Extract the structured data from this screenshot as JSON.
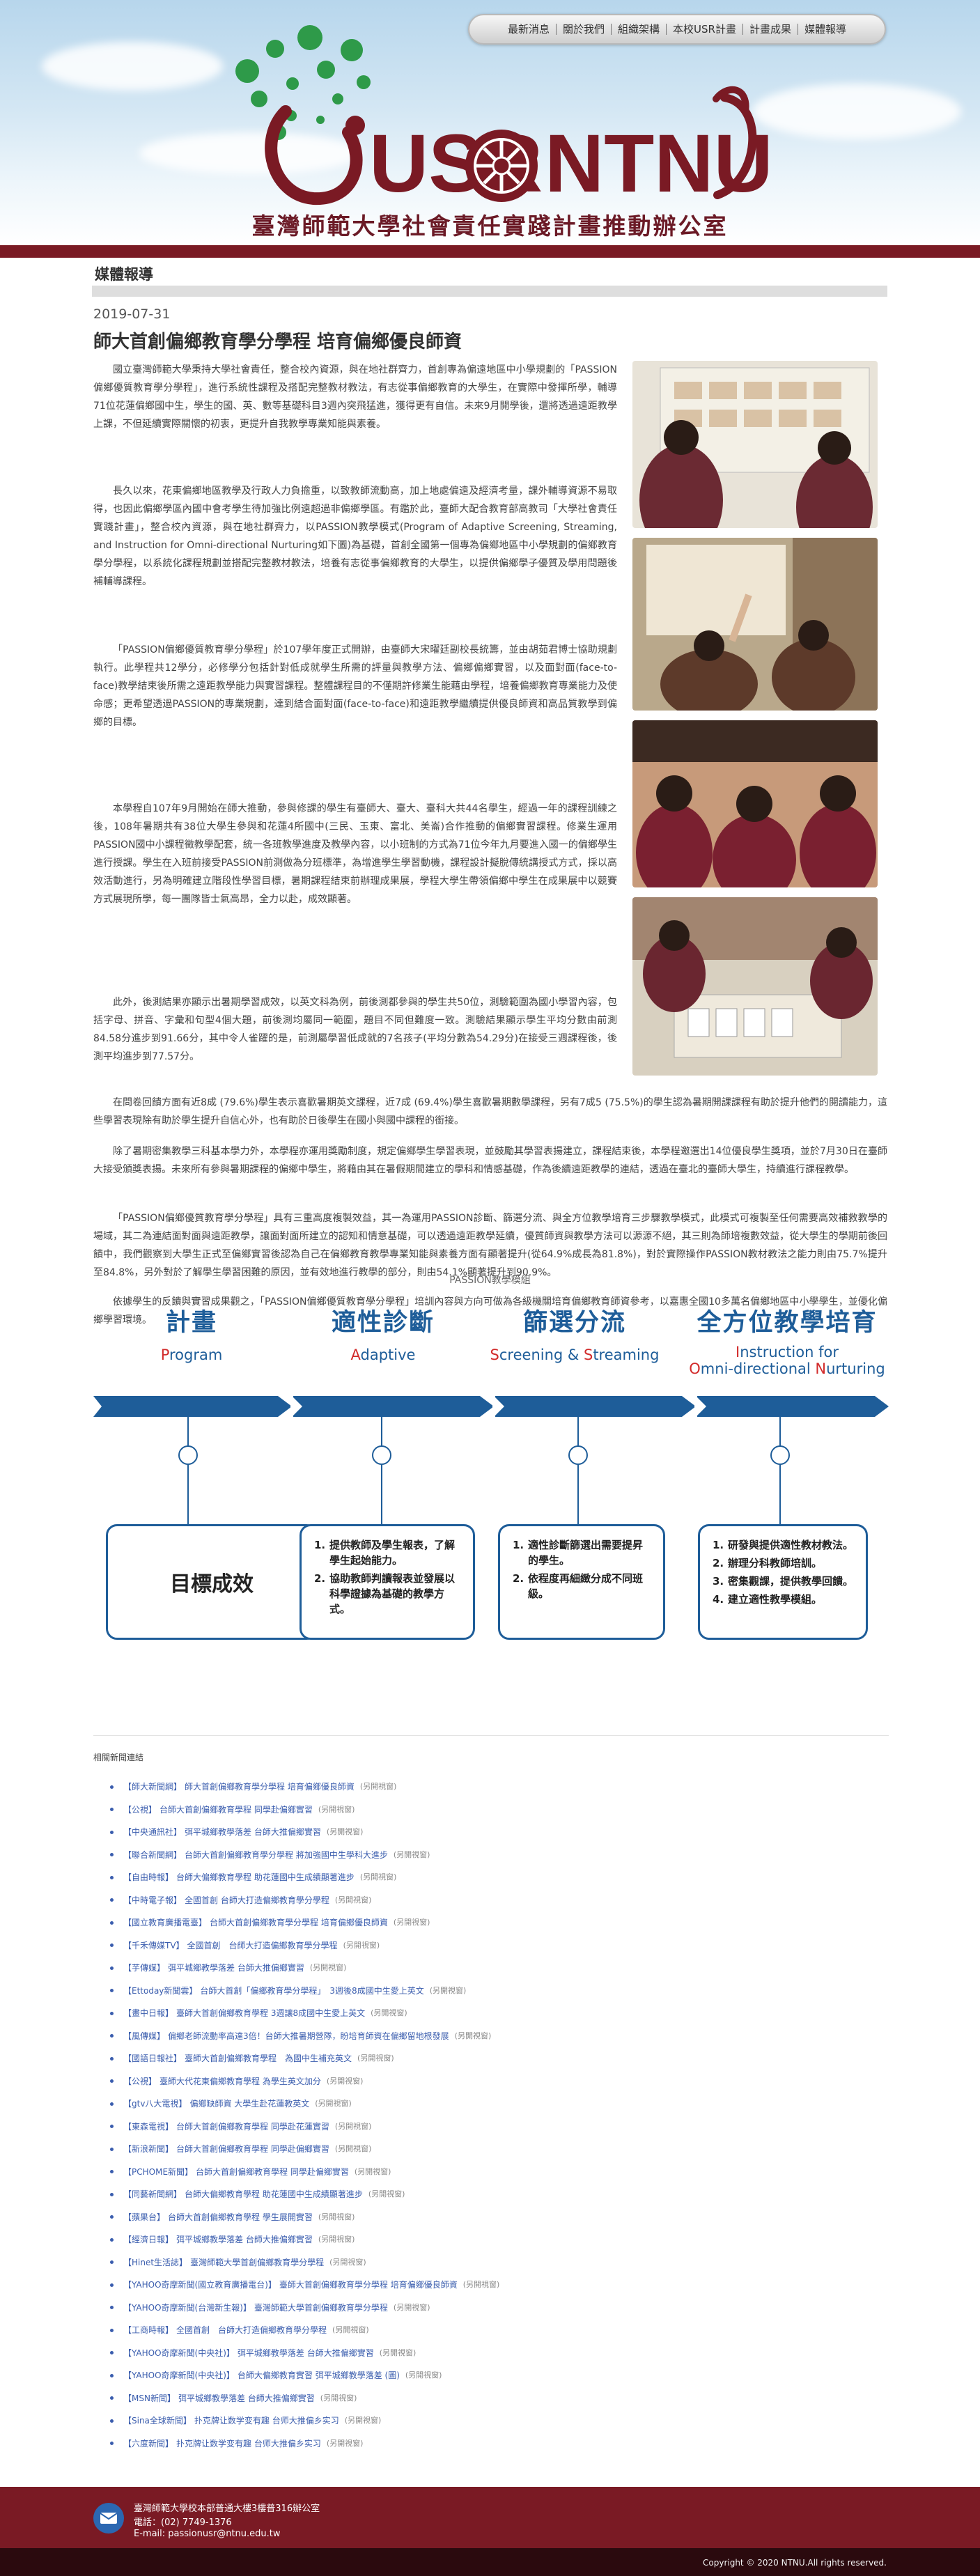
{
  "nav": [
    "最新消息",
    "關於我們",
    "組織架構",
    "本校USR計畫",
    "計畫成果",
    "媒體報導"
  ],
  "brand": {
    "logo_left": "USR",
    "logo_right": "NTNU",
    "logo_letter_o_symbol": "⊕",
    "subtitle": "臺灣師範大學社會責任實踐計畫推動辦公室",
    "maroon": "#7a1a24",
    "green": "#2e9a49",
    "blue": "#1e5d99"
  },
  "section_title": "媒體報導",
  "post": {
    "date": "2019-07-31",
    "title": "師大首創偏鄉教育學分學程 培育偏鄉優良師資",
    "paragraphs": [
      "國立臺灣師範大學秉持大學社會責任，整合校內資源，與在地社群齊力，首創專為偏遠地區中小學規劃的「PASSION偏鄉優質教育學分學程」，進行系統性課程及搭配完整教材教法，有志從事偏鄉教育的大學生，在實際中發揮所學，輔導71位花蓮偏鄉國中生，學生的國、英、數等基礎科目3週內突飛猛進，獲得更有自信。未來9月開學後，還將透過遠距教學上課，不但延續實際關懷的初衷，更提升自我教學專業知能與素養。",
      "長久以來，花東偏鄉地區教學及行政人力負擔重，以致教師流動高，加上地處偏遠及經濟考量，課外輔導資源不易取得，也因此偏鄉學區內國中會考學生待加強比例遠超過非偏鄉學區。有鑑於此，臺師大配合教育部高教司「大學社會責任實踐計畫」，整合校內資源，與在地社群齊力，以PASSION教學模式(Program of Adaptive Screening, Streaming, and Instruction for Omni-directional Nurturing如下圖)為基礎，首創全國第一個專為偏鄉地區中小學規劃的偏鄉教育學分學程，以系統化課程規劃並搭配完整教材教法，培養有志從事偏鄉教育的大學生，以提供偏鄉學子優質及學用問題後補輔導課程。",
      "「PASSION偏鄉優質教育學分學程」於107學年度正式開辦，由臺師大宋曜廷副校長統籌，並由胡茹君博士協助規劃執行。此學程共12學分，必修學分包括針對低成就學生所需的評量與教學方法、偏鄉偏鄉實習，以及面對面(face-to-face)教學結束後所需之遠距教學能力與實習課程。整體課程目的不僅期許修業生能藉由學程，培養偏鄉教育專業能力及使命感；更希望透過PASSION的專業規劃，達到結合面對面(face-to-face)和遠距教學繼續提供優良師資和高品質教學到偏鄉的目標。",
      "本學程自107年9月開始在師大推動，參與修課的學生有臺師大、臺大、臺科大共44名學生，經過一年的課程訓練之後，108年暑期共有38位大學生參與和花蓮4所國中(三民、玉東、富北、美崙)合作推動的偏鄉實習課程。修業生運用PASSION國中小課程徵教學配套，統一各班教學進度及教學內容，以小班制的方式為71位今年九月要進入國一的偏鄉學生進行授課。學生在入班前接受PASSION前測做為分班標準，為增進學生學習動機，課程設計擬脫傳統講授式方式，採以高效活動進行，另為明確建立階段性學習目標，暑期課程結束前辦理成果展，學程大學生帶領偏鄉中學生在成果展中以競賽方式展現所學，每一團隊皆士氣高昂，全力以赴，成效顯著。",
      "此外，後測結果亦顯示出暑期學習成效，以英文科為例，前後測都參與的學生共50位，測驗範圍為國小學習內容，包括字母、拼音、字彙和句型4個大題，前後測均屬同一範圍，題目不同但難度一致。測驗結果顯示學生平均分數由前測84.58分進步到91.66分，其中令人雀躍的是，前測屬學習低成就的7名孩子(平均分數為54.29分)在接受三週課程後，後測平均進步到77.57分。",
      "在問卷回饋方面有近8成 (79.6%)學生表示喜歡暑期英文課程，近7成 (69.4%)學生喜歡暑期數學課程，另有7成5 (75.5%)的學生認為暑期開課課程有助於提升他們的閱讀能力，這些學習表現除有助於學生提升自信心外，也有助於日後學生在國小與國中課程的銜接。",
      "除了暑期密集教學三科基本學力外，本學程亦運用獎勵制度，規定偏鄉學生學習表現，並鼓勵其學習表揚建立，課程結束後，本學程邀選出14位優良學生獎項，並於7月30日在臺師大接受頒獎表揚。未來所有參與暑期課程的偏鄉中學生，將藉由其在暑假期間建立的學科和情感基礎，作為後續遠距教學的連結，透過在臺北的臺師大學生，持續進行課程教學。",
      "「PASSION偏鄉優質教育學分學程」具有三重高度複製效益，其一為運用PASSION診斷、篩選分流、與全方位教學培育三步驟教學模式，此模式可複製至任何需要高效補救教學的場域，其二為連結面對面與遠距教學，讓面對面所建立的認知和情意基礎，可以透過遠距教學延續，優質師資與教學方法可以源源不絕，其三則為師培複數效益，從大學生的學期前後回饋中，我們觀察到大學生正式至偏鄉實習後認為自己在偏鄉教育教學專業知能與素養方面有顯著提升(從64.9%成長為81.8%)，對於實際操作PASSION教材教法之能力則由75.7%提升至84.8%，另外對於了解學生學習困難的原因，並有效地進行教學的部分，則由54.1%顯著提升到90.9%。",
      "依據學生的反饋與實習成果觀之，「PASSION偏鄉優質教育學分學程」培訓內容與方向可做為各級機關培育偏鄉教育師資參考，以嘉惠全國10多萬名偏鄉地區中小學學生，並優化偏鄉學習環境。"
    ],
    "photos": [
      {
        "label": "photo-classroom-board",
        "colors": [
          "#6b2a33",
          "#d9c2a5",
          "#e8e3d8"
        ]
      },
      {
        "label": "photo-classroom-students-hands-up",
        "colors": [
          "#5d3a2a",
          "#b9a88b",
          "#efe6d4"
        ]
      },
      {
        "label": "photo-students-group",
        "colors": [
          "#7a2030",
          "#3c2a22",
          "#c79a7a"
        ]
      },
      {
        "label": "photo-students-game",
        "colors": [
          "#6a2630",
          "#a28570",
          "#d8d0c0"
        ]
      }
    ]
  },
  "diagram": {
    "caption": "PASSION教學模組",
    "stages": [
      {
        "zh": "計畫",
        "en_first": "P",
        "en_rest": "rogram"
      },
      {
        "zh": "適性診斷",
        "en_first": "A",
        "en_rest": "daptive"
      },
      {
        "zh": "篩選分流",
        "en_first": "S",
        "en_rest": "creening & ",
        "en_second": "S",
        "en_rest2": "treaming"
      },
      {
        "zh": "全方位教學培育",
        "en_first": "I",
        "en_rest": "nstruction for",
        "en_line2_first": "O",
        "en_line2_mid": "mni-directional ",
        "en_line2_second": "N",
        "en_line2_rest": "urturing"
      }
    ],
    "goal": "目標成效",
    "boxes": [
      [
        "提供教師及學生報表，了解學生起始能力。",
        "協助教師判讀報表並發展以科學證據為基礎的教學方式。"
      ],
      [
        "適性診斷篩選出需要提昇的學生。",
        "依程度再細緻分成不同班級。"
      ],
      [
        "研發與提供適性教材教法。",
        "辦理分科教師培訓。",
        "密集觀課，提供教學回饋。",
        "建立適性教學模組。"
      ]
    ]
  },
  "links": {
    "title": "相關新聞連結",
    "new_label": "(另開視窗)",
    "items": [
      {
        "src": "【師大新聞網】",
        "title": "師大首創偏鄉教育學分學程 培育偏鄉優良師資"
      },
      {
        "src": "【公視】",
        "title": "台師大首創偏鄉教育學程 同學赴偏鄉實習"
      },
      {
        "src": "【中央通訊社】",
        "title": "弭平城鄉教學落差 台師大推偏鄉實習"
      },
      {
        "src": "【聯合新聞網】",
        "title": "台師大首創偏鄉教育學分學程 將加強國中生學科大進步"
      },
      {
        "src": "【自由時報】",
        "title": "台師大偏鄉教育學程 助花蓮國中生成績顯著進步"
      },
      {
        "src": "【中時電子報】",
        "title": "全國首創 台師大打造偏鄉教育學分學程"
      },
      {
        "src": "【國立教育廣播電臺】",
        "title": "台師大首創偏鄉教育學分學程 培育偏鄉優良師資"
      },
      {
        "src": "【千禾傳媒TV】",
        "title": "全國首創　台師大打造偏鄉教育學分學程"
      },
      {
        "src": "【芋傳媒】",
        "title": "弭平城鄉教學落差 台師大推偏鄉實習"
      },
      {
        "src": "【Ettoday新聞雲】",
        "title": "台師大首創「偏鄉教育學分學程」　3週後8成國中生愛上英文"
      },
      {
        "src": "【畫中日報】",
        "title": "臺師大首創偏鄉教育學程 3週讓8成國中生愛上英文"
      },
      {
        "src": "【風傳媒】",
        "title": "偏鄉老師流動率高達3倍！台師大推暑期營隊，盼培育師資在偏鄉留地根發展"
      },
      {
        "src": "【國語日報社】",
        "title": "臺師大首創偏鄉教育學程　為國中生補充英文"
      },
      {
        "src": "【公視】",
        "title": "臺師大代花東偏鄉教育學程 為學生英文加分"
      },
      {
        "src": "【gtv八大電視】",
        "title": "偏鄉缺師資 大學生赴花蓮教英文"
      },
      {
        "src": "【東森電視】",
        "title": "台師大首創偏鄉教育學程 同學赴花蓮實習"
      },
      {
        "src": "【新浪新聞】",
        "title": "台師大首創偏鄉教育學程 同學赴偏鄉實習"
      },
      {
        "src": "【PCHOME新聞】",
        "title": "台師大首創偏鄉教育學程 同學赴偏鄉實習"
      },
      {
        "src": "【同藝新聞網】",
        "title": "台師大偏鄉教育學程 助花蓮國中生成績顯著進步"
      },
      {
        "src": "【蘋果台】",
        "title": "台師大首創偏鄉教育學程 學生展開實習"
      },
      {
        "src": "【經濟日報】",
        "title": "弭平城鄉教學落差 台師大推偏鄉實習"
      },
      {
        "src": "【Hinet生活誌】",
        "title": "臺灣師範大學首創偏鄉教育學分學程"
      },
      {
        "src": "【YAHOO奇摩新聞(國立教育廣播電台)】",
        "title": "臺師大首創偏鄉教育學分學程 培育偏鄉優良師資"
      },
      {
        "src": "【YAHOO奇摩新聞(台灣新生報)】",
        "title": "臺灣師範大學首創偏鄉教育學分學程"
      },
      {
        "src": "【工商時報】",
        "title": "全國首創　台師大打造偏鄉教育學分學程"
      },
      {
        "src": "【YAHOO奇摩新聞(中央社)】",
        "title": "弭平城鄉教學落差 台師大推偏鄉實習"
      },
      {
        "src": "【YAHOO奇摩新聞(中央社)】",
        "title": "台師大偏鄉教育實習 弭平城鄉教學落差 (圖)"
      },
      {
        "src": "【MSN新聞】",
        "title": "弭平城鄉教學落差 台師大推偏鄉實習"
      },
      {
        "src": "【Sina全球新聞】",
        "title": "扑克牌让数学变有趣 台师大推偏乡实习"
      },
      {
        "src": "【六度新聞】",
        "title": "扑克牌让数学变有趣 台师大推偏乡实习"
      }
    ]
  },
  "footer": {
    "address": "臺灣師範大學校本部普通大樓3樓普316辦公室",
    "phone": "電話：(02) 7749-1376",
    "email": "E-mail: passionusr@ntnu.edu.tw",
    "copyright": "Copyright © 2020 NTNU.All rights reserved."
  }
}
